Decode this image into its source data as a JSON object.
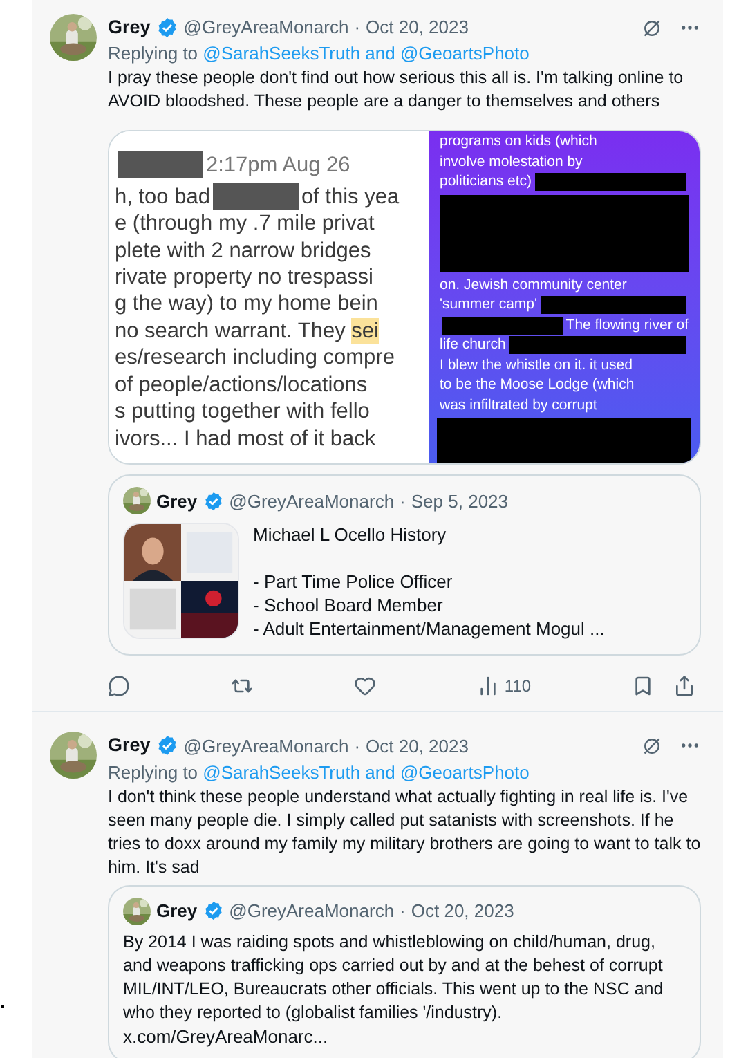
{
  "tweets": [
    {
      "author": {
        "name": "Grey",
        "verified": true,
        "handle": "@GreyAreaMonarch",
        "separator": "·",
        "date": "Oct 20, 2023"
      },
      "reply": {
        "prefix": "Replying to",
        "mentions": "@SarahSeeksTruth and @GeoartsPhoto"
      },
      "text": "I pray these people don't find out how serious this all is. I'm talking online to AVOID bloodshed. These people are a danger to themselves and others",
      "media": [
        {
          "kind": "light",
          "lines": [
            [
              {
                "kind": "redacted"
              },
              {
                "kind": "text",
                "text": "2:17pm Aug 26"
              }
            ],
            [
              {
                "kind": "text",
                "text": "h, too bad"
              },
              {
                "kind": "redacted"
              },
              {
                "kind": "text",
                "text": "of this yea"
              }
            ],
            [
              {
                "kind": "text",
                "text": "e (through my .7 mile privat"
              }
            ],
            [
              {
                "kind": "text",
                "text": "plete with 2 narrow bridges"
              }
            ],
            [
              {
                "kind": "text",
                "text": "rivate property no trespassi"
              }
            ],
            [
              {
                "kind": "text",
                "text": "g the way) to my home bein"
              }
            ],
            [
              {
                "kind": "text",
                "text": "no search warrant. They "
              },
              {
                "kind": "highlight",
                "text": "sei"
              }
            ],
            [
              {
                "kind": "text",
                "text": "es/research including compre"
              }
            ],
            [
              {
                "kind": "text",
                "text": "of people/actions/locations"
              }
            ],
            [
              {
                "kind": "text",
                "text": "s putting together with fello"
              }
            ],
            [
              {
                "kind": "text",
                "text": "ivors... I had most of it back"
              }
            ]
          ]
        },
        {
          "kind": "purple",
          "lines": [
            [
              {
                "kind": "text",
                "text": "programs on kids (which"
              }
            ],
            [
              {
                "kind": "text",
                "text": "involve molestation by"
              }
            ],
            [
              {
                "kind": "text",
                "text": "politicians etc)"
              },
              {
                "kind": "redacted"
              }
            ],
            [
              {
                "kind": "block"
              }
            ],
            [
              {
                "kind": "text",
                "text": "on. Jewish community center"
              }
            ],
            [
              {
                "kind": "text",
                "text": "'summer camp'"
              },
              {
                "kind": "redacted"
              }
            ],
            [
              {
                "kind": "redacted"
              },
              {
                "kind": "text",
                "text": "The flowing river of"
              }
            ],
            [
              {
                "kind": "text",
                "text": "life church"
              },
              {
                "kind": "redacted"
              }
            ],
            [
              {
                "kind": "text",
                "text": "I blew the whistle on it. it used"
              }
            ],
            [
              {
                "kind": "text",
                "text": "to be the Moose Lodge (which"
              }
            ],
            [
              {
                "kind": "text",
                "text": "was infiltrated by corrupt"
              }
            ],
            [
              {
                "kind": "block"
              }
            ]
          ]
        }
      ],
      "quote": {
        "name": "Grey",
        "verified": true,
        "handle": "@GreyAreaMonarch",
        "date": "Sep 5, 2023",
        "title": "Michael L Ocello History",
        "items": [
          "- Part Time Police Officer",
          "- School Board Member",
          "- Adult Entertainment/Management Mogul ..."
        ],
        "separator": "·"
      },
      "actions": {
        "views": "110"
      }
    },
    {
      "author": {
        "name": "Grey",
        "verified": true,
        "handle": "@GreyAreaMonarch",
        "separator": "·",
        "date": "Oct 20, 2023"
      },
      "reply": {
        "prefix": "Replying to",
        "mentions": "@SarahSeeksTruth and @GeoartsPhoto"
      },
      "text": "I don't think these people understand what actually fighting in real life is. I've seen many people die. I simply called put satanists with screenshots. If he tries to doxx around my family my military brothers are going to want to talk to him. It's sad",
      "quote": {
        "name": "Grey",
        "verified": true,
        "handle": "@GreyAreaMonarch",
        "separator": "·",
        "date": "Oct 20, 2023",
        "text": "By 2014 I was raiding spots and whistleblowing on child/human, drug, and weapons trafficking ops carried out by and at the behest of corrupt MIL/INT/LEO, Bureaucrats other officials. This went up to the NSC and who they reported to (globalist families '/industry).",
        "link": "x.com/GreyAreaMonarc..."
      }
    }
  ]
}
